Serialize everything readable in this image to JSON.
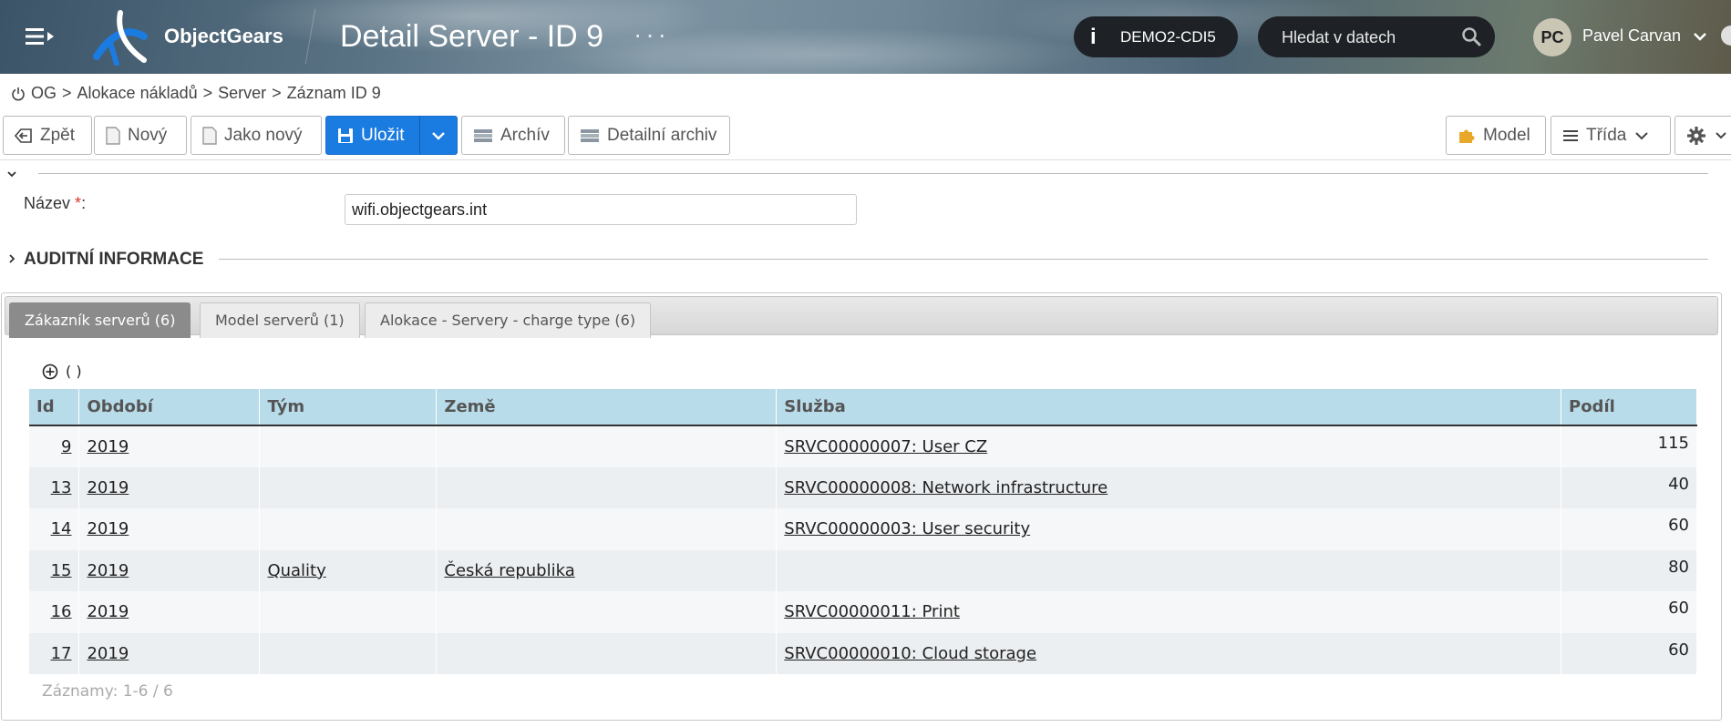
{
  "header": {
    "brand": "ObjectGears",
    "title": "Detail Server - ID 9",
    "dots": "···",
    "env_label": "DEMO2-CDI5",
    "search_placeholder": "Hledat v datech",
    "user_initials": "PC",
    "user_name": "Pavel Carvan"
  },
  "breadcrumb": {
    "items": [
      "OG",
      "Alokace nákladů",
      "Server",
      "Záznam ID 9"
    ],
    "separator": ">"
  },
  "toolbar": {
    "back": "Zpět",
    "new": "Nový",
    "as_new": "Jako nový",
    "save": "Uložit",
    "archive": "Archív",
    "detail_archive": "Detailní archiv",
    "model": "Model",
    "class": "Třída"
  },
  "form": {
    "name_label": "Název",
    "required_mark": "*",
    "colon": ":",
    "name_value": "wifi.objectgears.int",
    "audit_title": "AUDITNÍ INFORMACE"
  },
  "tabs": [
    {
      "label": "Zákazník serverů (6)",
      "active": true
    },
    {
      "label": "Model serverů (1)",
      "active": false
    },
    {
      "label": "Alokace - Servery - charge type (6)",
      "active": false
    }
  ],
  "grid": {
    "add_label": "( )",
    "columns": [
      "Id",
      "Období",
      "Tým",
      "Země",
      "Služba",
      "Podíl"
    ],
    "rows": [
      {
        "id": "9",
        "period": "2019",
        "team": "",
        "country": "",
        "service": "SRVC00000007: User CZ",
        "share": "115"
      },
      {
        "id": "13",
        "period": "2019",
        "team": "",
        "country": "",
        "service": "SRVC00000008: Network infrastructure",
        "share": "40"
      },
      {
        "id": "14",
        "period": "2019",
        "team": "",
        "country": "",
        "service": "SRVC00000003: User security",
        "share": "60"
      },
      {
        "id": "15",
        "period": "2019",
        "team": "Quality",
        "country": "Česká republika",
        "service": "",
        "share": "80"
      },
      {
        "id": "16",
        "period": "2019",
        "team": "",
        "country": "",
        "service": "SRVC00000011: Print",
        "share": "60"
      },
      {
        "id": "17",
        "period": "2019",
        "team": "",
        "country": "",
        "service": "SRVC00000010: Cloud storage",
        "share": "60"
      }
    ],
    "records": "Záznamy: 1-6 / 6"
  },
  "colors": {
    "primary": "#1a7be0",
    "grid_header": "#b9dcea",
    "active_tab": "#8b8b8b",
    "env_pill": "#1e2226"
  }
}
